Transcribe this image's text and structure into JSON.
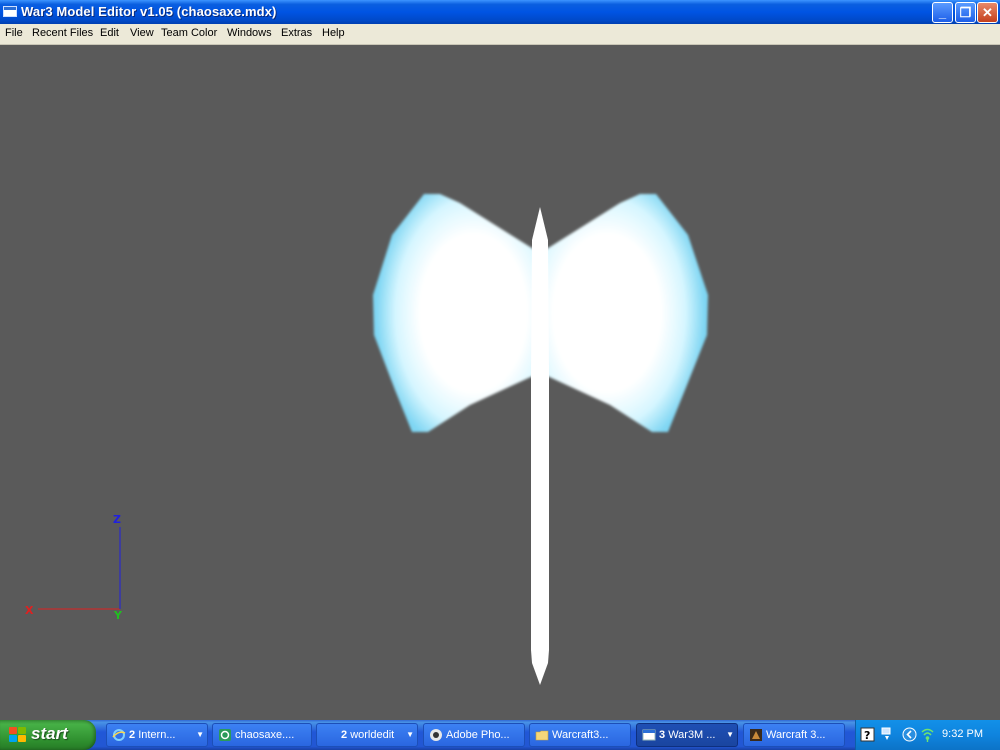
{
  "window": {
    "title": "War3 Model Editor v1.05 (chaosaxe.mdx)",
    "buttons": {
      "minimize": "_",
      "maximize": "❐",
      "close": "✕"
    }
  },
  "menu": [
    "File",
    "Recent Files",
    "Edit",
    "View",
    "Team Color",
    "Windows",
    "Extras",
    "Help"
  ],
  "viewport": {
    "background": "#5a5a5a",
    "model": "chaosaxe.mdx",
    "axes": {
      "x_label": "X",
      "y_label": "Y",
      "z_label": "Z",
      "x_color": "#e02020",
      "y_color": "#20c020",
      "z_color": "#2020e0"
    }
  },
  "taskbar": {
    "start_label": "start",
    "items": [
      {
        "count": "2",
        "label": "Intern...",
        "icon": "internet-explorer-icon",
        "grouped": true
      },
      {
        "count": "",
        "label": "chaosaxe....",
        "icon": "app-icon",
        "grouped": false
      },
      {
        "count": "2",
        "label": "worldedit",
        "icon": "",
        "grouped": true
      },
      {
        "count": "",
        "label": "Adobe Pho...",
        "icon": "photoshop-icon",
        "grouped": false
      },
      {
        "count": "",
        "label": "Warcraft3...",
        "icon": "folder-icon",
        "grouped": false
      },
      {
        "count": "3",
        "label": "War3M ...",
        "icon": "window-icon",
        "grouped": true,
        "active": true
      },
      {
        "count": "",
        "label": "Warcraft 3...",
        "icon": "warcraft-icon",
        "grouped": false
      }
    ],
    "tray": {
      "clock": "9:32 PM"
    }
  }
}
